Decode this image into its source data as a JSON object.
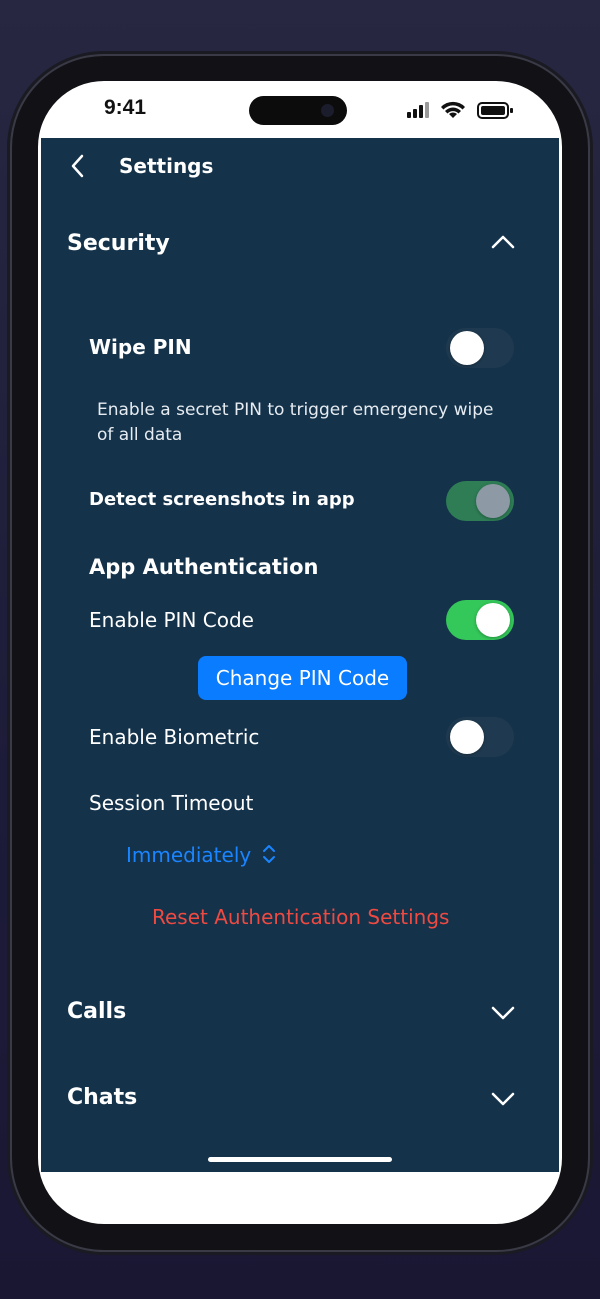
{
  "status_bar": {
    "time": "9:41"
  },
  "header": {
    "title": "Settings"
  },
  "sections": {
    "security": {
      "title": "Security"
    },
    "calls": {
      "title": "Calls"
    },
    "chats": {
      "title": "Chats"
    }
  },
  "security": {
    "wipe_pin": {
      "label": "Wipe PIN",
      "enabled": false,
      "description_line1": "Enable a secret PIN to trigger emergency wipe",
      "description_line2": "of all data"
    },
    "detect_screenshots": {
      "label": "Detect screenshots in app",
      "enabled": true
    },
    "app_auth_heading": "App Authentication",
    "enable_pin": {
      "label": "Enable PIN Code",
      "enabled": true
    },
    "change_pin_label": "Change PIN Code",
    "enable_biometric": {
      "label": "Enable Biometric",
      "enabled": false
    },
    "session_timeout": {
      "label": "Session Timeout",
      "value": "Immediately"
    },
    "reset_label": "Reset Authentication Settings"
  },
  "colors": {
    "background": "#14324a",
    "accent_blue": "#0a7cff",
    "link_blue": "#1a85ff",
    "destructive_red": "#ef4a42",
    "toggle_on_green": "#34c759",
    "toggle_dim_green": "#2e7d55",
    "toggle_off": "#1f3a50"
  },
  "icons": {
    "back": "chevron-left-icon",
    "collapse": "chevron-up-icon",
    "expand": "chevron-down-icon",
    "picker": "chevron-up-down-icon"
  }
}
